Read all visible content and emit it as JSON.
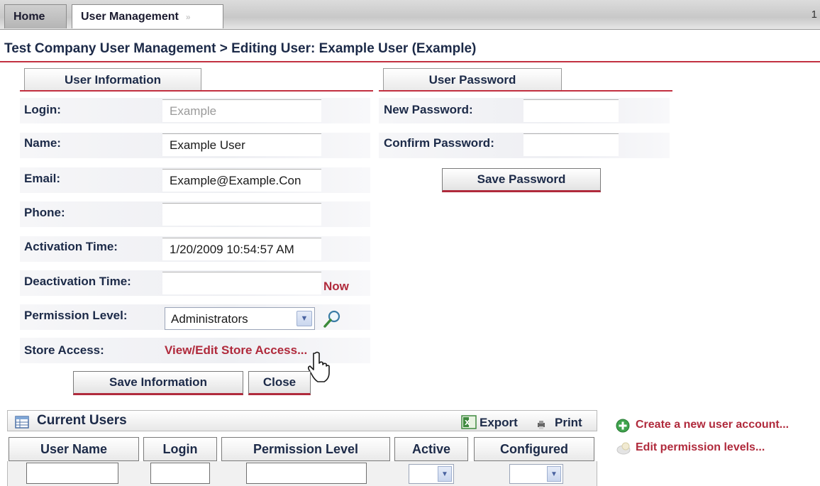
{
  "tabs": {
    "home": "Home",
    "user_management": "User Management",
    "close_glyph": "»",
    "page_num": "1"
  },
  "breadcrumb": "Test Company User Management > Editing User: Example User (Example)",
  "user_info": {
    "tab_label": "User Information",
    "login_label": "Login:",
    "login_value": "Example",
    "name_label": "Name:",
    "name_value": "Example User",
    "email_label": "Email:",
    "email_value": "Example@Example.Con",
    "phone_label": "Phone:",
    "phone_value": "",
    "activation_label": "Activation Time:",
    "activation_value": "1/20/2009 10:54:57 AM",
    "deactivation_label": "Deactivation Time:",
    "deactivation_value": "",
    "now_link": "Now",
    "permission_label": "Permission Level:",
    "permission_value": "Administrators",
    "store_label": "Store Access:",
    "store_link": "View/Edit Store Access...",
    "save_button": "Save Information",
    "close_button": "Close"
  },
  "password": {
    "tab_label": "User Password",
    "new_label": "New Password:",
    "confirm_label": "Confirm Password:",
    "save_button": "Save Password"
  },
  "grid": {
    "title": "Current Users",
    "export": "Export",
    "print": "Print",
    "columns": [
      "User Name",
      "Login",
      "Permission Level",
      "Active",
      "Configured"
    ]
  },
  "side_links": {
    "create": "Create a new user account...",
    "edit_levels": "Edit permission levels..."
  },
  "colors": {
    "accent": "#b02a3c",
    "text": "#1c2a48"
  }
}
